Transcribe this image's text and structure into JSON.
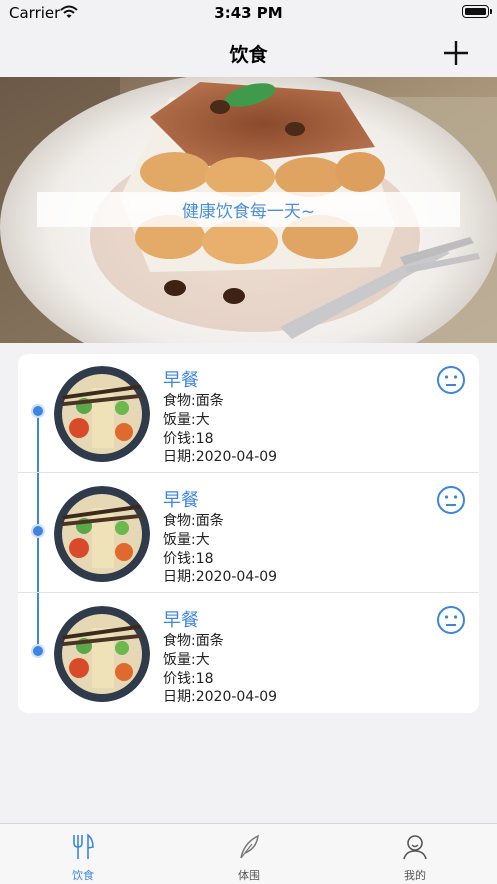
{
  "status_bar": {
    "carrier": "Carrier",
    "time": "3:43 PM"
  },
  "nav": {
    "title": "饮食",
    "add_icon": "plus-icon"
  },
  "banner": {
    "text": "健康饮食每一天~"
  },
  "meals": [
    {
      "meal": "早餐",
      "food": "食物:面条",
      "portion": "饭量:大",
      "price": "价钱:18",
      "date": "日期:2020-04-09",
      "mood_icon": "neutral-face-icon"
    },
    {
      "meal": "早餐",
      "food": "食物:面条",
      "portion": "饭量:大",
      "price": "价钱:18",
      "date": "日期:2020-04-09",
      "mood_icon": "neutral-face-icon"
    },
    {
      "meal": "早餐",
      "food": "食物:面条",
      "portion": "饭量:大",
      "price": "价钱:18",
      "date": "日期:2020-04-09",
      "mood_icon": "neutral-face-icon"
    }
  ],
  "tabs": [
    {
      "label": "饮食",
      "icon": "fork-knife-icon",
      "active": true
    },
    {
      "label": "体围",
      "icon": "feather-icon",
      "active": false
    },
    {
      "label": "我的",
      "icon": "person-icon",
      "active": false
    }
  ],
  "colors": {
    "accent": "#3d86e0",
    "background": "#f2f2f4"
  }
}
